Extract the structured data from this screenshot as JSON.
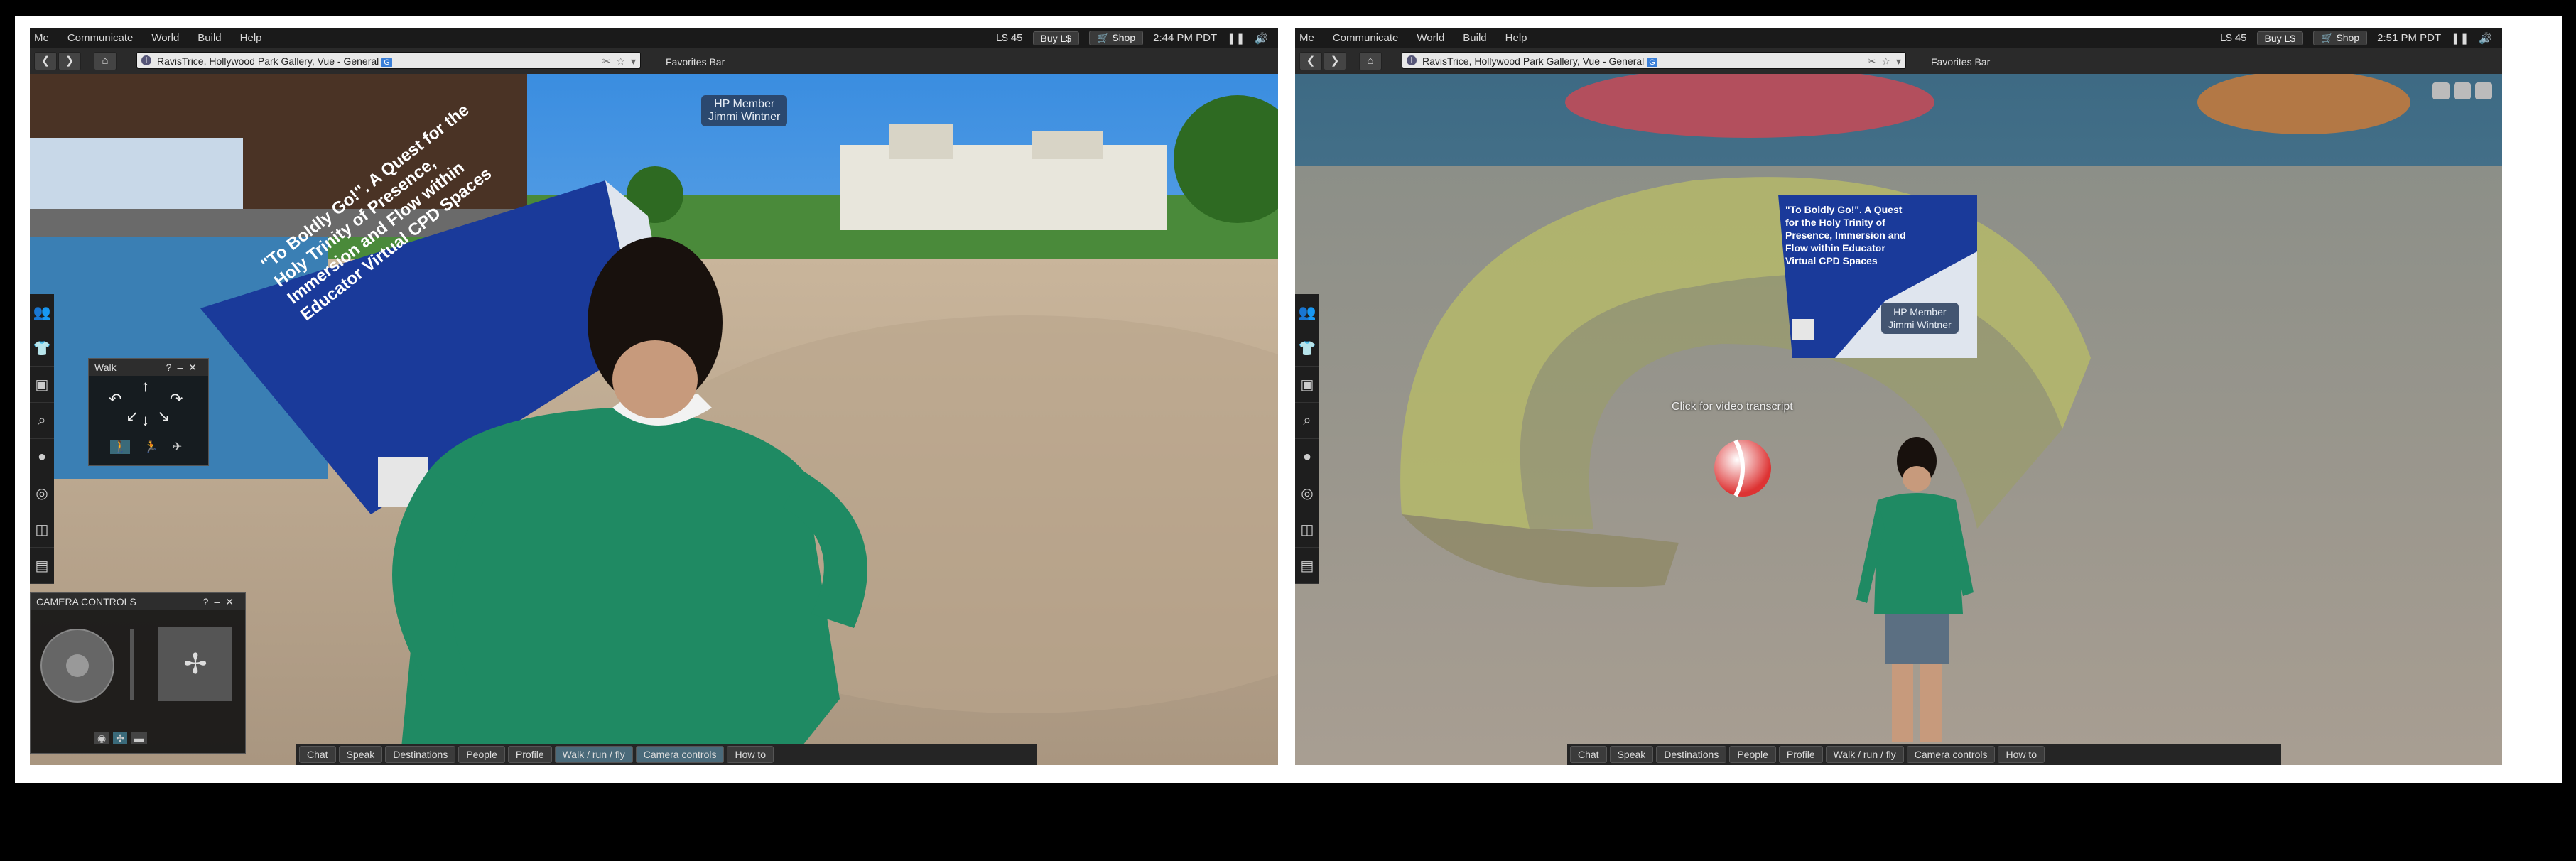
{
  "menus": [
    "Me",
    "Communicate",
    "World",
    "Build",
    "Help"
  ],
  "left": {
    "balance": "L$ 45",
    "buy_label": "Buy L$",
    "shop_label": "Shop",
    "time": "2:44 PM PDT",
    "location": "RavisTrice, Hollywood Park Gallery, Vue - General",
    "favorites": "Favorites Bar",
    "walk_title": "Walk",
    "camera_title": "CAMERA CONTROLS",
    "nametag": [
      "HP Member",
      "Jimmi Wintner"
    ],
    "poster_text": "\"To Boldly Go!\". A Quest for the Holy Trinity of Presence, Immersion and Flow within Educator Virtual CPD Spaces",
    "bottom": [
      "Chat",
      "Speak",
      "Destinations",
      "People",
      "Profile",
      "Walk / run / fly",
      "Camera controls",
      "How to"
    ],
    "active_bottom": [
      5,
      6
    ]
  },
  "right": {
    "balance": "L$ 45",
    "buy_label": "Buy L$",
    "shop_label": "Shop",
    "time": "2:51 PM PDT",
    "location": "RavisTrice, Hollywood Park Gallery, Vue - General",
    "favorites": "Favorites Bar",
    "nametag": [
      "HP Member",
      "Jimmi Wintner"
    ],
    "poster_text": "\"To Boldly Go!\". A Quest for the Holy Trinity of Presence, Immersion and Flow within Educator Virtual CPD Spaces",
    "hint": "Click for video transcript",
    "bottom": [
      "Chat",
      "Speak",
      "Destinations",
      "People",
      "Profile",
      "Walk / run / fly",
      "Camera controls",
      "How to"
    ],
    "active_bottom": []
  },
  "sidebar_icons": [
    "people-icon",
    "appearance-icon",
    "inventory-icon",
    "search-icon",
    "places-icon",
    "landmarks-icon",
    "snapshot-icon",
    "help-icon"
  ],
  "colors": {
    "shirt": "#1f8a63",
    "poster": "#1a3a9a",
    "dome": "#b5b86a"
  }
}
